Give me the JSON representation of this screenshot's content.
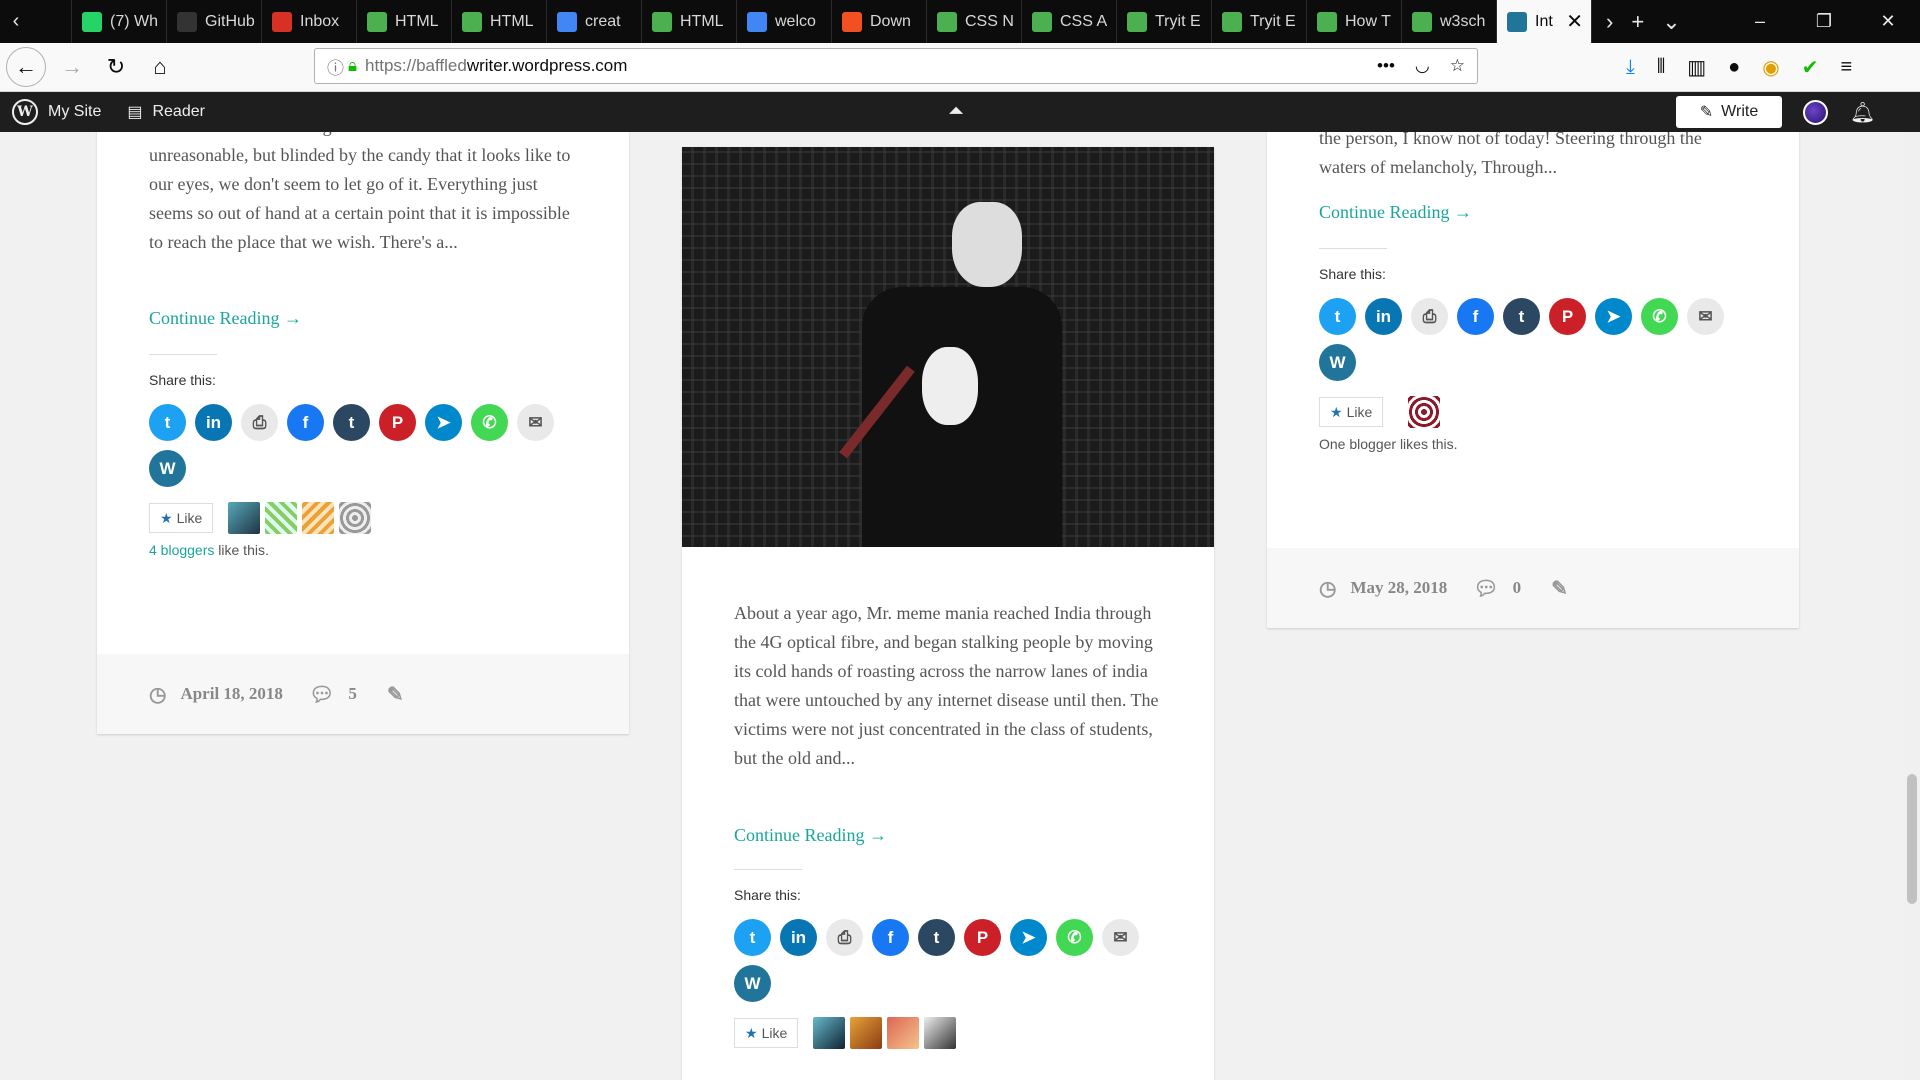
{
  "browser": {
    "tabs": [
      {
        "label": "(7) Wh",
        "favicon": "whatsapp-icon",
        "color": "#25d366"
      },
      {
        "label": "GitHub",
        "favicon": "github-icon",
        "color": "#333333"
      },
      {
        "label": "Inbox",
        "favicon": "gmail-icon",
        "color": "#d93025"
      },
      {
        "label": "HTML",
        "favicon": "w3schools-icon",
        "color": "#4caf50"
      },
      {
        "label": "HTML",
        "favicon": "w3schools-icon",
        "color": "#4caf50"
      },
      {
        "label": "creat",
        "favicon": "google-icon",
        "color": "#4285f4"
      },
      {
        "label": "HTML",
        "favicon": "w3schools-icon",
        "color": "#4caf50"
      },
      {
        "label": "welco",
        "favicon": "google-icon",
        "color": "#4285f4"
      },
      {
        "label": "Down",
        "favicon": "microsoft-icon",
        "color": "#f25022"
      },
      {
        "label": "CSS N",
        "favicon": "w3schools-icon",
        "color": "#4caf50"
      },
      {
        "label": "CSS A",
        "favicon": "w3schools-icon",
        "color": "#4caf50"
      },
      {
        "label": "Tryit E",
        "favicon": "w3schools-icon",
        "color": "#4caf50"
      },
      {
        "label": "Tryit E",
        "favicon": "w3schools-icon",
        "color": "#4caf50"
      },
      {
        "label": "How T",
        "favicon": "w3schools-icon",
        "color": "#4caf50"
      },
      {
        "label": "w3sch",
        "favicon": "w3schools-icon",
        "color": "#4caf50"
      },
      {
        "label": "Int",
        "favicon": "wordpress-icon",
        "color": "#21759b",
        "active": true
      }
    ],
    "url_prefix": "https://baffled",
    "url_domain": "writer.wordpress.com"
  },
  "wpbar": {
    "my_site": "My Site",
    "reader": "Reader",
    "write": "Write"
  },
  "posts": [
    {
      "excerpt": "Often what we're chasing in life is so futile and unreasonable, but blinded by the candy that it looks like to our eyes, we don't seem to let go of it. Everything just seems so out of hand at a certain point that it is impossible to reach the place that we wish. There's a...",
      "read_more": "Continue Reading →",
      "share_label": "Share this:",
      "like_label": "Like",
      "likers_link": "4 bloggers",
      "likers_text": " like this.",
      "date": "April 18, 2018",
      "comments": "5"
    },
    {
      "excerpt": "About a year ago, Mr. meme mania reached India through the 4G optical fibre, and began stalking people by moving its cold hands of roasting across the narrow lanes of india that were untouched by any internet disease until then. The victims were not just concentrated in the class of students, but the old and...",
      "read_more": "Continue Reading →",
      "share_label": "Share this:",
      "like_label": "Like"
    },
    {
      "excerpt": "the person, I know not of today! Steering through the waters of melancholy, Through...",
      "read_more": "Continue Reading →",
      "share_label": "Share this:",
      "like_label": "Like",
      "likers_text": "One blogger likes this.",
      "date": "May 28, 2018",
      "comments": "0"
    }
  ],
  "share_buttons": [
    {
      "name": "twitter",
      "glyph": "t",
      "color": "#1da1f2"
    },
    {
      "name": "linkedin",
      "glyph": "in",
      "color": "#0976b4"
    },
    {
      "name": "print",
      "glyph": "⎙",
      "color": "#e9e9e9"
    },
    {
      "name": "facebook",
      "glyph": "f",
      "color": "#1877f2"
    },
    {
      "name": "tumblr",
      "glyph": "t",
      "color": "#2c4762"
    },
    {
      "name": "pinterest",
      "glyph": "P",
      "color": "#cb2027"
    },
    {
      "name": "telegram",
      "glyph": "➤",
      "color": "#0088cc"
    },
    {
      "name": "whatsapp",
      "glyph": "✆",
      "color": "#43d854"
    },
    {
      "name": "email",
      "glyph": "✉",
      "color": "#e9e9e9"
    },
    {
      "name": "wordpress",
      "glyph": "W",
      "color": "#21759b"
    }
  ]
}
